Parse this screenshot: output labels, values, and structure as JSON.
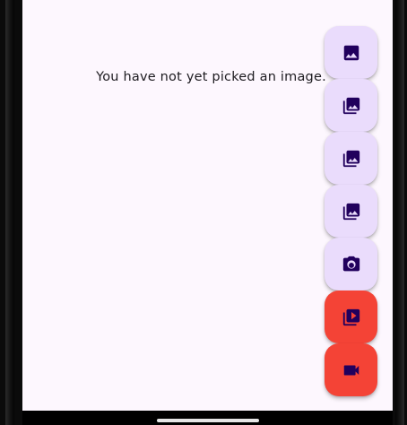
{
  "main": {
    "message": "You have not yet picked an image."
  },
  "fabs": [
    {
      "icon": "image-icon",
      "color": "#eadcfc"
    },
    {
      "icon": "photo-library-icon",
      "color": "#eadcfc"
    },
    {
      "icon": "photo-library-icon",
      "color": "#eadcfc"
    },
    {
      "icon": "photo-library-icon",
      "color": "#eadcfc"
    },
    {
      "icon": "camera-icon",
      "color": "#eadcfc"
    },
    {
      "icon": "video-library-icon",
      "color": "#f44336"
    },
    {
      "icon": "videocam-icon",
      "color": "#f44336"
    }
  ],
  "colors": {
    "background": "#fdf7fe",
    "fab_light": "#eadcfc",
    "fab_red": "#f44336",
    "icon": "#21005d",
    "text": "#1d1b20"
  }
}
